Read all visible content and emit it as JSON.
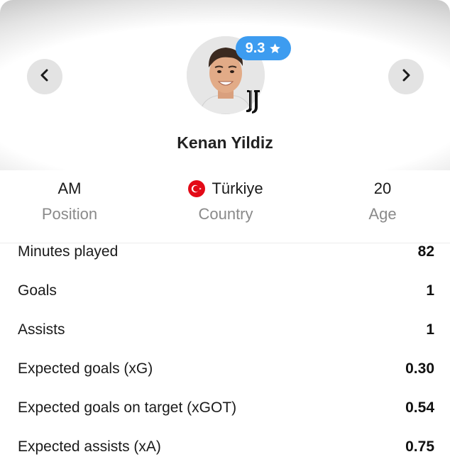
{
  "player": {
    "name": "Kenan Yildiz",
    "rating": "9.3",
    "photo_icon": "player-photo",
    "club_icon": "juventus-crest-icon"
  },
  "nav": {
    "prev_icon": "chevron-left-icon",
    "next_icon": "chevron-right-icon"
  },
  "info": [
    {
      "value": "AM",
      "label": "Position"
    },
    {
      "value": "Türkiye",
      "label": "Country",
      "icon": "turkey-flag-icon"
    },
    {
      "value": "20",
      "label": "Age"
    }
  ],
  "stats": [
    {
      "label": "Minutes played",
      "value": "82"
    },
    {
      "label": "Goals",
      "value": "1"
    },
    {
      "label": "Assists",
      "value": "1"
    },
    {
      "label": "Expected goals (xG)",
      "value": "0.30"
    },
    {
      "label": "Expected goals on target (xGOT)",
      "value": "0.54"
    },
    {
      "label": "Expected assists (xA)",
      "value": "0.75"
    }
  ],
  "colors": {
    "rating_badge": "#3d9cf0",
    "flag_red": "#e30a17",
    "muted_label": "#8a8a8a"
  }
}
